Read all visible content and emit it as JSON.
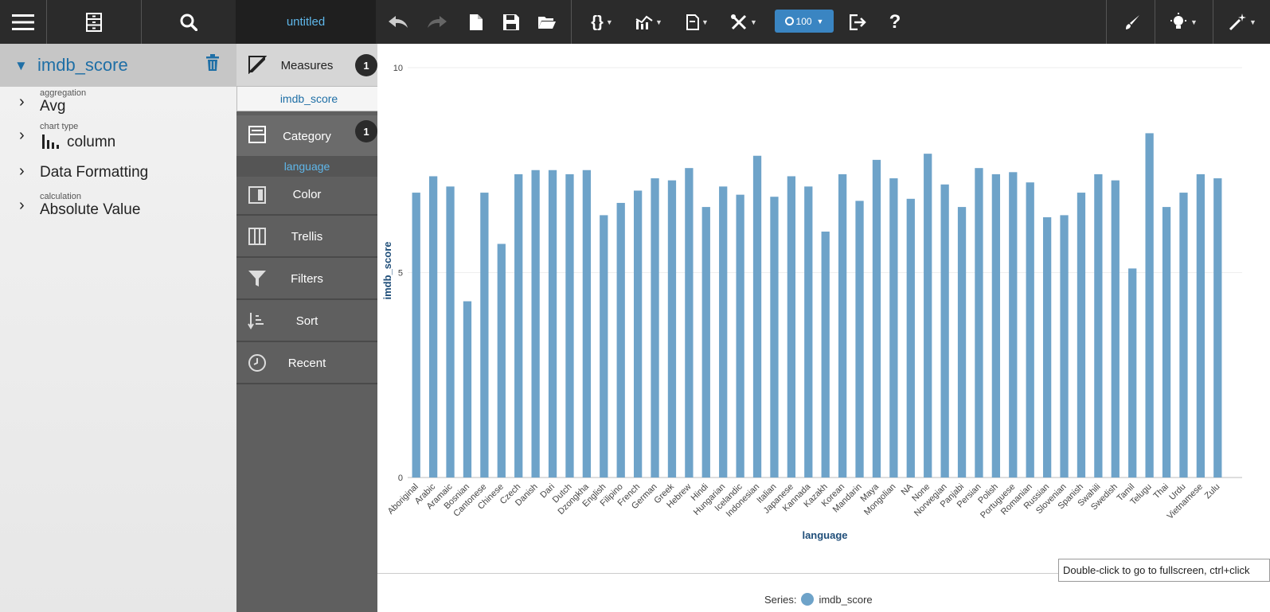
{
  "toolbar": {
    "file_title": "untitled",
    "zoom_value": "100"
  },
  "props": {
    "title": "imdb_score",
    "items": [
      {
        "small": "aggregation",
        "big": "Avg"
      },
      {
        "small": "chart type",
        "big": "column"
      },
      {
        "small": "",
        "big": "Data Formatting"
      },
      {
        "small": "calculation",
        "big": "Absolute Value"
      }
    ]
  },
  "shelf": {
    "measures_label": "Measures",
    "measures_count": "1",
    "measure_field": "imdb_score",
    "category_label": "Category",
    "category_count": "1",
    "category_field": "language",
    "color_label": "Color",
    "trellis_label": "Trellis",
    "filters_label": "Filters",
    "sort_label": "Sort",
    "recent_label": "Recent"
  },
  "chart_data": {
    "type": "bar",
    "categories": [
      "Aboriginal",
      "Arabic",
      "Aramaic",
      "Bosnian",
      "Cantonese",
      "Chinese",
      "Czech",
      "Danish",
      "Dari",
      "Dutch",
      "Dzongkha",
      "English",
      "Filipino",
      "French",
      "German",
      "Greek",
      "Hebrew",
      "Hindi",
      "Hungarian",
      "Icelandic",
      "Indonesian",
      "Italian",
      "Japanese",
      "Kannada",
      "Kazakh",
      "Korean",
      "Mandarin",
      "Maya",
      "Mongolian",
      "NA",
      "None",
      "Norwegian",
      "Panjabi",
      "Persian",
      "Polish",
      "Portuguese",
      "Romanian",
      "Russian",
      "Slovenian",
      "Spanish",
      "Swahili",
      "Swedish",
      "Tamil",
      "Telugu",
      "Thai",
      "Urdu",
      "Vietnamese",
      "Zulu"
    ],
    "values": [
      6.95,
      7.35,
      7.1,
      4.3,
      6.95,
      5.7,
      7.4,
      7.5,
      7.5,
      7.4,
      7.5,
      6.4,
      6.7,
      7.0,
      7.3,
      7.25,
      7.55,
      6.6,
      7.1,
      6.9,
      7.85,
      6.85,
      7.35,
      7.1,
      6.0,
      7.4,
      6.75,
      7.75,
      7.3,
      6.8,
      7.9,
      7.15,
      6.6,
      7.55,
      7.4,
      7.45,
      7.2,
      6.35,
      6.4,
      6.95,
      7.4,
      7.25,
      5.1,
      8.4,
      6.6,
      6.95,
      7.4,
      7.3
    ],
    "xlabel": "language",
    "ylabel": "imdb_score",
    "ylim": [
      0,
      10
    ],
    "yticks": [
      0,
      5,
      10
    ],
    "grid": true,
    "color": "#6ea3c9",
    "legend_prefix": "Series:",
    "legend_name": "imdb_score",
    "legend_position": "bottom"
  },
  "tooltip_text": "Double-click to go to fullscreen, ctrl+click",
  "colors": {
    "toolbar_bg": "#2b2b2b",
    "accent": "#1f6fa6",
    "highlight": "#5fb7ea",
    "zoom_badge": "#3a85c2"
  }
}
